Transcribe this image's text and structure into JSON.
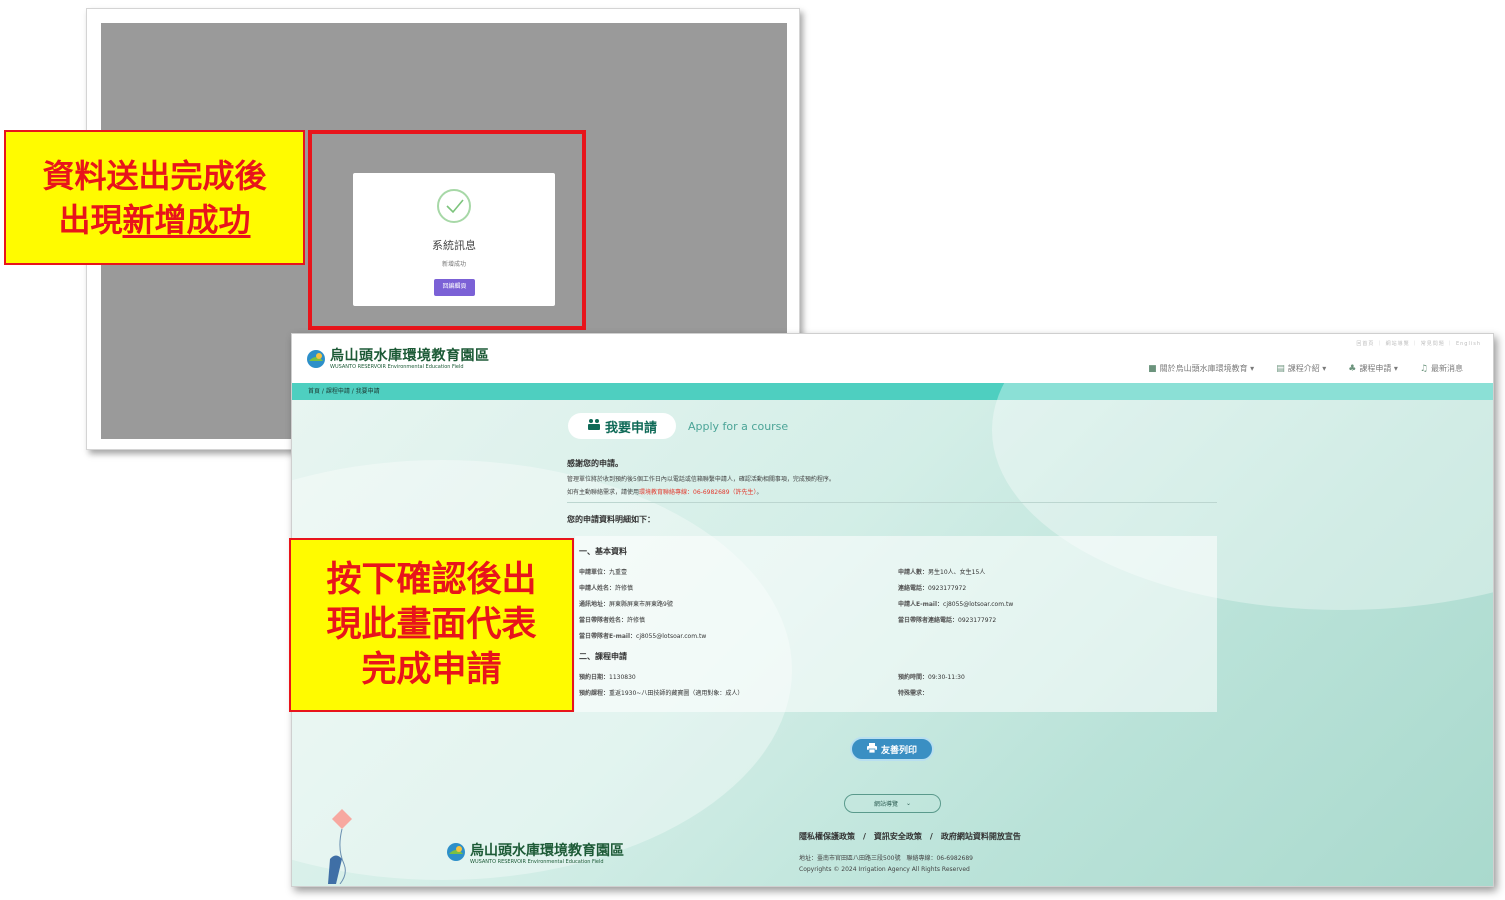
{
  "modal_screen": {
    "modal": {
      "title": "系統訊息",
      "message": "新增成功",
      "button_label": "回編輯頁"
    }
  },
  "callouts": {
    "first_line1": "資料送出完成後",
    "first_line2_prefix": "出現",
    "first_line2_emph": "新增成功",
    "second_line1": "按下確認後出",
    "second_line2": "現此畫面代表",
    "second_line3": "完成申請"
  },
  "site": {
    "logo_zh": "烏山頭水庫環境教育園區",
    "logo_en": "WUSANTO RESERVOIR Environmental Education Field",
    "util_links": "回首頁 ｜ 網站導覽 ｜ 常見問題 ｜ English",
    "nav": [
      {
        "icon": "book-icon",
        "glyph": "■",
        "label": "關於烏山頭水庫環境教育 ▾"
      },
      {
        "icon": "docs-icon",
        "glyph": "▤",
        "label": "課程介紹 ▾"
      },
      {
        "icon": "apply-icon",
        "glyph": "♣",
        "label": "課程申請 ▾"
      },
      {
        "icon": "news-icon",
        "glyph": "♫",
        "label": "最新消息"
      }
    ],
    "breadcrumb": "首頁 / 課程申請 / 我要申請"
  },
  "page": {
    "heading_zh": "我要申請",
    "heading_en": "Apply for a course",
    "thanks": "感謝您的申請。",
    "line1": "管理單位將於收到預約後5個工作日內以電話或信箱聯繫申請人，確認活動相關事項，完成預約程序。",
    "line2_prefix": "如有主動聯絡需求，請使用",
    "line2_red": "環境教育聯絡專線：06-6982689（許先生）",
    "line2_suffix": "。",
    "detail_title": "您的申請資料明細如下：",
    "section1_title": "一、基本資料",
    "section2_title": "二、課程申請",
    "basic_left": [
      {
        "k": "申請單位：",
        "v": "九重壹"
      },
      {
        "k": "申請人姓名：",
        "v": "許修慎"
      },
      {
        "k": "通訊地址：",
        "v": "屏東縣屏東市屏東路9號"
      },
      {
        "k": "當日帶隊者姓名：",
        "v": "許修慎"
      },
      {
        "k": "當日帶隊者E-mail：",
        "v": "cj8055@lotsoar.com.tw"
      }
    ],
    "basic_right": [
      {
        "k": "申請人數：",
        "v": "男生10人、女生15人"
      },
      {
        "k": "連絡電話：",
        "v": "0923177972"
      },
      {
        "k": "申請人E-mail：",
        "v": "cj8055@lotsoar.com.tw"
      },
      {
        "k": "當日帶隊者連絡電話：",
        "v": "0923177972"
      }
    ],
    "course_left": [
      {
        "k": "預約日期：",
        "v": "1130830"
      },
      {
        "k": "預約課程：",
        "v": "重返1930~八田技師的藏寶圖（適用對象：成人）"
      }
    ],
    "course_right": [
      {
        "k": "預約時間：",
        "v": "09:30-11:30"
      },
      {
        "k": "特殊需求：",
        "v": ""
      }
    ],
    "print_label": "友善列印",
    "notice_label": "網站導覽"
  },
  "footer": {
    "links": "隱私權保護政策　/　資訊安全政策　/　政府網站資料開放宣告",
    "address": "地址：臺南市官田區八田路三段500號　聯絡專線：06-6982689",
    "copyright": "Copyrights © 2024 Irrigation Agency All Rights Reserved"
  },
  "colors": {
    "highlight_red": "#e8141b",
    "callout_yellow": "#fffb00",
    "modal_button": "#7b61d6",
    "breadcrumb_teal": "#4ecfc0",
    "print_button": "#3a8fc3"
  }
}
